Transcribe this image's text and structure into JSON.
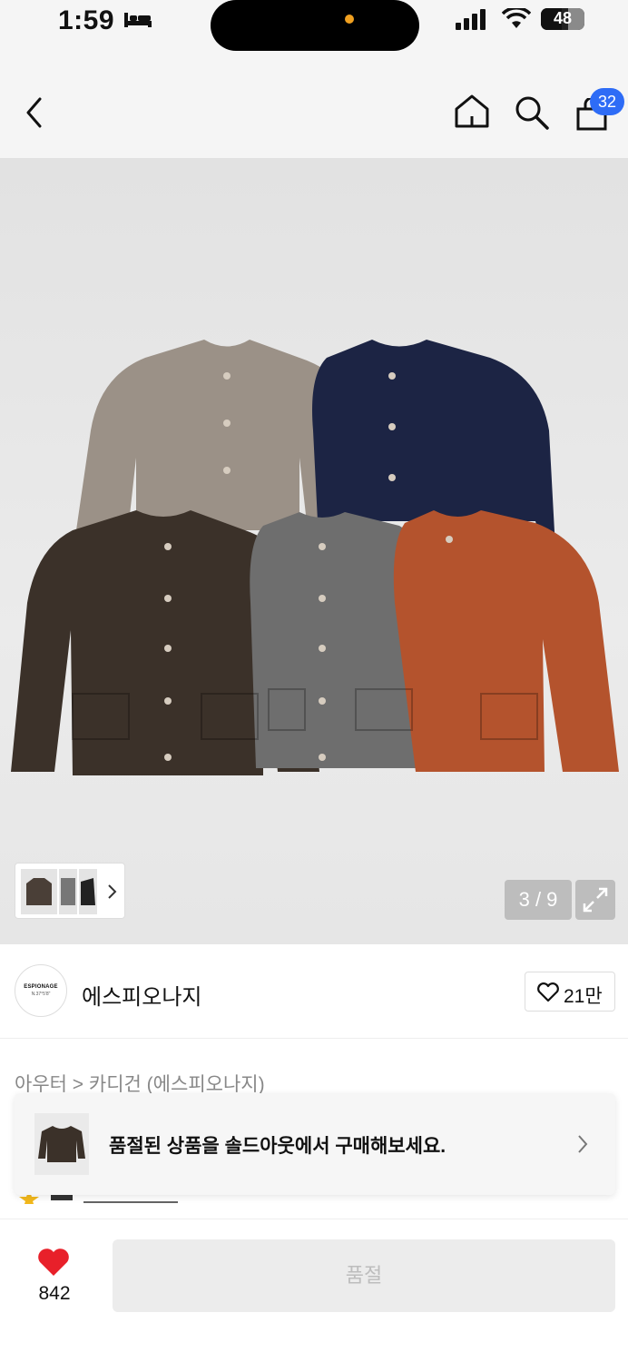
{
  "status_bar": {
    "time": "1:59",
    "battery": "48",
    "battery_level": 0.48
  },
  "nav": {
    "cart_count": "32"
  },
  "gallery": {
    "page_indicator": "3 / 9",
    "sweater_colors": [
      "#9b9187",
      "#1c2444",
      "#3b3129",
      "#6e6e6e",
      "#b4532d"
    ]
  },
  "brand": {
    "logo_text": "ESPIONAGE",
    "logo_sub": "N.37°5'8\"",
    "name": "에스피오나지",
    "like_count": "21만"
  },
  "category": "아우터 > 카디건 (에스피오나지)",
  "banner": {
    "text": "품절된 상품을 솔드아웃에서 구매해보세요."
  },
  "bottom_bar": {
    "heart_count": "842",
    "soldout_label": "품절"
  },
  "colors": {
    "accent_blue": "#2e6cf6",
    "heart_red": "#e8202a"
  }
}
